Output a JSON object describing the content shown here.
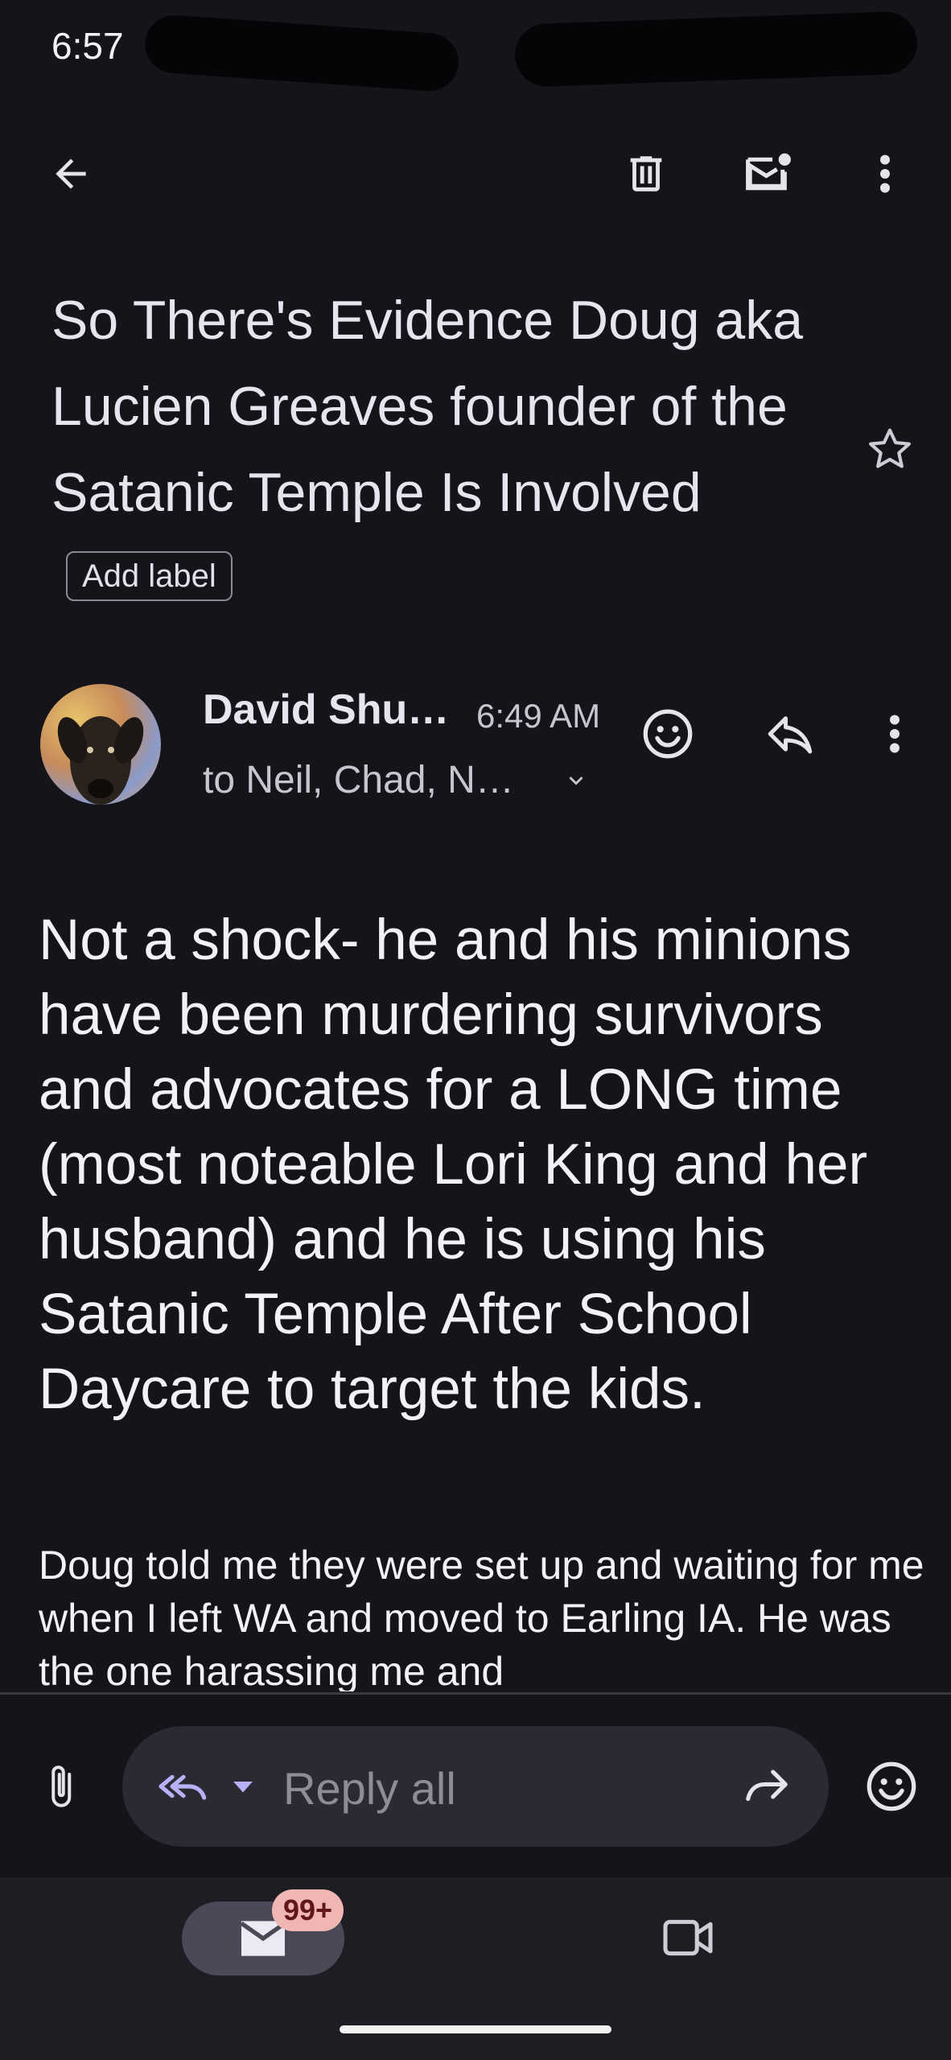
{
  "status_bar": {
    "time": "6:57"
  },
  "toolbar": {
    "back_icon": "arrow-left-icon",
    "delete_icon": "trash-icon",
    "mark_unread_icon": "mail-dot-icon",
    "more_icon": "more-vert-icon"
  },
  "email": {
    "subject": "So There's Evidence Doug aka Lucien Greaves founder of the Satanic Temple Is Involved",
    "add_label": "Add label",
    "star_icon": "star-outline-icon",
    "sender": {
      "name": "David Shu…",
      "time": "6:49 AM",
      "to": "to Neil, Chad, N…"
    },
    "body_large": "Not a shock- he and his minions have been murdering survivors and advocates for a LONG time (most noteable Lori King and her husband) and he is using his Satanic Temple After School Daycare to target the kids.",
    "body_small": "Doug told me they were set up and waiting for me when I left WA and moved to Earling IA. He was the one harassing me and"
  },
  "reply_bar": {
    "placeholder": "Reply all",
    "attach_icon": "paperclip-icon",
    "reply_all_icon": "reply-all-icon",
    "forward_icon": "forward-icon",
    "emoji_icon": "emoji-icon"
  },
  "bottom_nav": {
    "mail_badge": "99+",
    "mail_icon": "mail-icon",
    "meet_icon": "video-camera-icon"
  },
  "colors": {
    "background": "#14141a",
    "reply_accent": "#b8b0f5",
    "badge_bg": "#f0b6b3"
  }
}
